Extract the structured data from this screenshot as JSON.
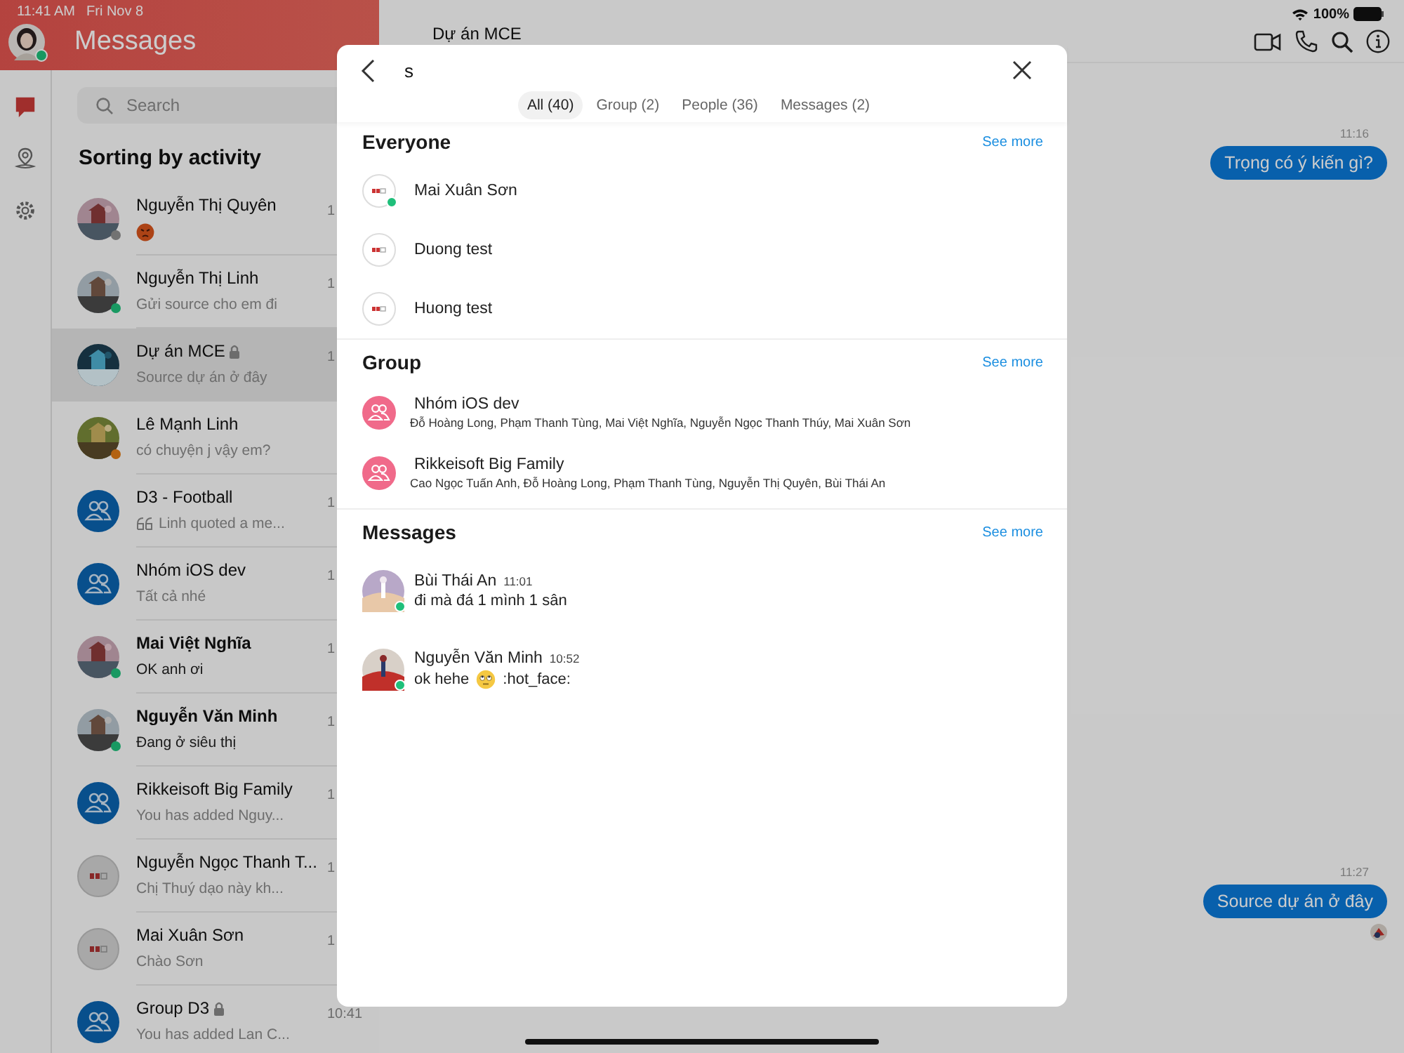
{
  "status_bar": {
    "time": "11:41 AM",
    "date": "Fri Nov 8",
    "battery": "100%"
  },
  "sidebar": {
    "title": "Messages",
    "profile_online": true,
    "rail": [
      {
        "kind": "chat",
        "selected": true
      },
      {
        "kind": "location",
        "selected": false
      },
      {
        "kind": "settings",
        "selected": false
      }
    ],
    "search": {
      "placeholder": "Search"
    },
    "heading": "Sorting by activity",
    "conversations": [
      {
        "name": "Nguyễn Thị Quyên",
        "preview_icon": {
          "kind": "emoji"
        },
        "time": "1",
        "color": "#727272",
        "unread": false,
        "locked": false,
        "selected": false
      },
      {
        "name": "Nguyễn Thị Linh",
        "preview": "Gửi source cho em đi",
        "time": "1",
        "color": "#199962",
        "unread": false,
        "locked": false,
        "selected": false
      },
      {
        "name": "Dự án MCE",
        "preview": "Source dự án ở đây",
        "time": "1",
        "unread": false,
        "locked": true,
        "selected": true
      },
      {
        "name": "Lê Mạnh Linh",
        "preview": "có chuyện j vậy em?",
        "color": "#b36212",
        "unread": false,
        "locked": false,
        "selected": false
      },
      {
        "name": "D3 - Football",
        "preview_icon": {
          "kind": "quote"
        },
        "preview": "Linh quoted a me...",
        "time": "1",
        "avatar": {
          "kind": "group"
        },
        "unread": false,
        "locked": false,
        "selected": false
      },
      {
        "name": "Nhóm iOS dev",
        "preview": "Tất cả nhé",
        "time": "1",
        "avatar": {
          "kind": "group"
        },
        "unread": false,
        "locked": false,
        "selected": false
      },
      {
        "name": "Mai Việt Nghĩa",
        "preview": "OK anh ơi",
        "time": "1",
        "color": "#199962",
        "unread": true,
        "locked": false,
        "selected": false
      },
      {
        "name": "Nguyễn Văn Minh",
        "preview": "Đang ở siêu thị",
        "time": "1",
        "color": "#199962",
        "unread": true,
        "locked": false,
        "selected": false
      },
      {
        "name": "Rikkeisoft Big Family",
        "preview": "You has added Nguy...",
        "time": "1",
        "avatar": {
          "kind": "group"
        },
        "unread": false,
        "locked": false,
        "selected": false
      },
      {
        "name": "Nguyễn Ngọc Thanh T...",
        "preview": "Chị Thuý dạo này kh...",
        "time": "1",
        "avatar": {
          "kind": "logo"
        },
        "unread": false,
        "locked": false,
        "selected": false
      },
      {
        "name": "Mai Xuân Sơn",
        "preview": "Chào Sơn",
        "time": "1",
        "avatar": {
          "kind": "logo"
        },
        "unread": false,
        "locked": false,
        "selected": false
      },
      {
        "name": "Group D3",
        "preview": "You has added Lan C...",
        "time": "10:41",
        "avatar": {
          "kind": "group"
        },
        "unread": false,
        "locked": true,
        "selected": false
      }
    ]
  },
  "chat": {
    "title": "Dự án MCE",
    "messages": [
      {
        "time": "11:16",
        "text": "Trọng có ý kiến gì?"
      },
      {
        "time": "11:27",
        "text": "Source dự án ở đây"
      }
    ]
  },
  "search_dialog": {
    "query": "s",
    "tabs": [
      {
        "label": "All (40)",
        "selected": true
      },
      {
        "label": "Group (2)",
        "selected": false
      },
      {
        "label": "People (36)",
        "selected": false
      },
      {
        "label": "Messages (2)",
        "selected": false
      }
    ],
    "sections": [
      {
        "kind": "people",
        "title": "Everyone",
        "see_more": "See more",
        "items": [
          {
            "name": "Mai Xuân Sơn",
            "online": true
          },
          {
            "name": "Duong test",
            "online": false
          },
          {
            "name": "Huong test",
            "online": false
          }
        ]
      },
      {
        "kind": "groups",
        "title": "Group",
        "see_more": "See more",
        "items": [
          {
            "name": "Nhóm iOS dev",
            "members": "Đỗ Hoàng Long, Phạm Thanh Tùng, Mai Việt Nghĩa, Nguyễn Ngọc Thanh Thúy, Mai Xuân Sơn"
          },
          {
            "name": "Rikkeisoft Big Family",
            "members": "Cao Ngọc Tuấn Anh, Đỗ Hoàng Long, Phạm Thanh Tùng, Nguyễn Thị Quyên, Bùi Thái An"
          }
        ]
      },
      {
        "kind": "messages",
        "title": "Messages",
        "see_more": "See more",
        "items": [
          {
            "name": "Bùi Thái An",
            "time": "11:01",
            "text": "đi mà đá 1 mình 1 sân",
            "emoji": false,
            "online": true
          },
          {
            "name": "Nguyễn Văn Minh",
            "time": "10:52",
            "text": "ok hehe",
            "emoji": true,
            "text_after": ":hot_face:",
            "online": true
          }
        ]
      }
    ]
  }
}
